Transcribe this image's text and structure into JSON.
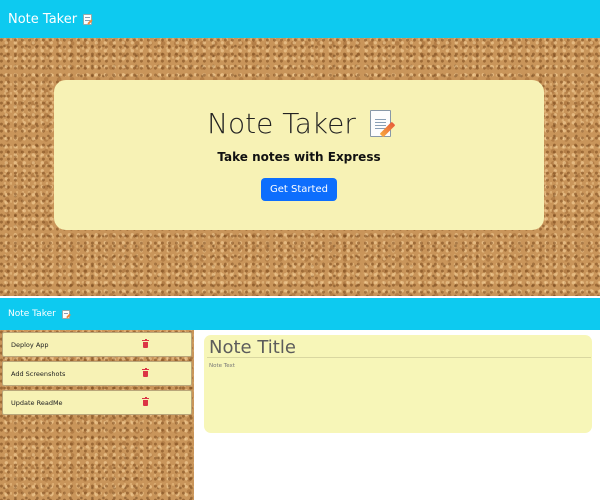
{
  "landing": {
    "navbar": {
      "brand": "Note Taker",
      "icon": "memo-icon"
    },
    "hero": {
      "title": "Note Taker",
      "title_icon": "memo-icon",
      "lead": "Take notes with Express",
      "cta_label": "Get Started",
      "cta_color": "#0d6efd"
    }
  },
  "notes_page": {
    "navbar": {
      "brand": "Note Taker",
      "icon": "memo-icon"
    },
    "notes": [
      {
        "title": "Deploy App"
      },
      {
        "title": "Add Screenshots"
      },
      {
        "title": "Update ReadMe"
      }
    ],
    "delete_icon": "trash-icon",
    "editor": {
      "title_placeholder": "Note Title",
      "text_placeholder": "Note Text"
    }
  },
  "colors": {
    "navbar": "#0dcaf0",
    "note_paper": "#f7f2b5",
    "delete": "#dc3545",
    "background_texture": "corkboard"
  }
}
